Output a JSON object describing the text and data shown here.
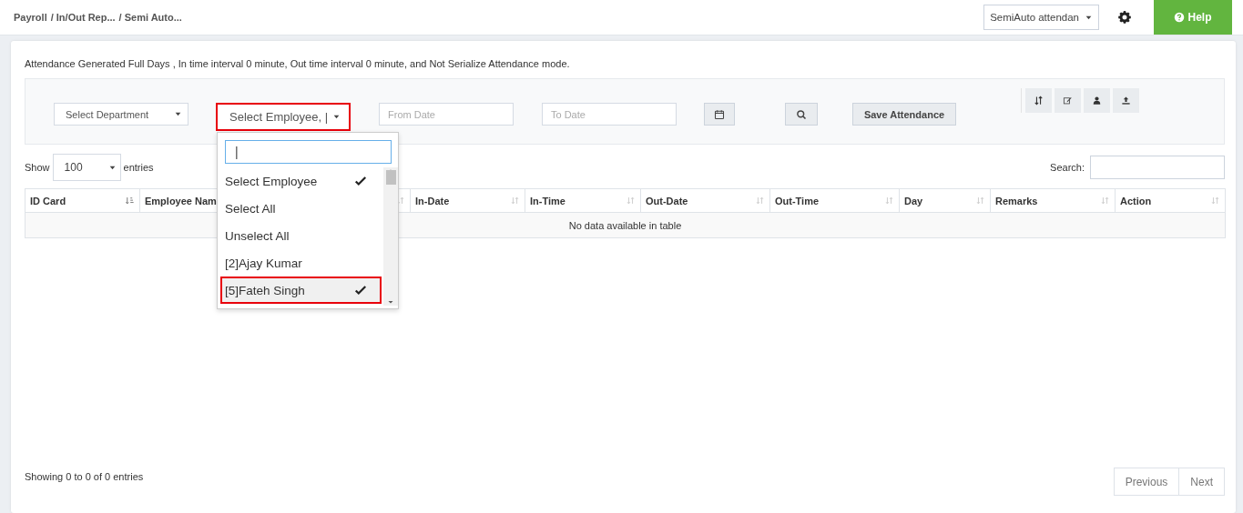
{
  "breadcrumb": [
    {
      "label": "Payroll"
    },
    {
      "label": "/ In/Out Rep..."
    },
    {
      "label": "/ Semi Auto..."
    }
  ],
  "mode_select": {
    "value": "SemiAuto attendan"
  },
  "help_button": {
    "label": "Help"
  },
  "info_text": "Attendance Generated Full Days , In time interval 0 minute, Out time interval 0 minute, and Not Serialize Attendance mode.",
  "filters": {
    "department": {
      "value": "Select Department"
    },
    "employee": {
      "value": "Select Employee, |",
      "highlighted": true
    },
    "from_date": {
      "placeholder": "From Date"
    },
    "to_date": {
      "placeholder": "To Date"
    },
    "save_button": "Save Attendance"
  },
  "employee_dropdown": {
    "search": {
      "value": "|"
    },
    "options": [
      {
        "label": "Select Employee",
        "checked": true,
        "highlighted": false
      },
      {
        "label": "Select All",
        "checked": false,
        "highlighted": false
      },
      {
        "label": "Unselect All",
        "checked": false,
        "highlighted": false
      },
      {
        "label": "[2]Ajay Kumar",
        "checked": false,
        "highlighted": false
      },
      {
        "label": "[5]Fateh Singh",
        "checked": true,
        "highlighted": true
      }
    ]
  },
  "show_entries": {
    "label_before": "Show",
    "value": "100",
    "label_after": "entries"
  },
  "search_label": "Search:",
  "table": {
    "columns": [
      {
        "label": "ID Card",
        "sorted": true
      },
      {
        "label": "Employee Nam"
      },
      {
        "sorted": false
      },
      {
        "label": "In-Date",
        "sorted": false
      },
      {
        "label": "In-Time",
        "sorted": false
      },
      {
        "label": "Out-Date",
        "sorted": false
      },
      {
        "label": "Out-Time",
        "sorted": false
      },
      {
        "label": "Day",
        "sorted": false
      },
      {
        "label": "Remarks",
        "sorted": false
      },
      {
        "label": "Action",
        "sorted": false
      }
    ],
    "empty_message": "No data available in table"
  },
  "footer": {
    "info": "Showing 0 to 0 of 0 entries",
    "pagination": [
      {
        "label": "Previous"
      },
      {
        "label": "Next"
      }
    ]
  }
}
